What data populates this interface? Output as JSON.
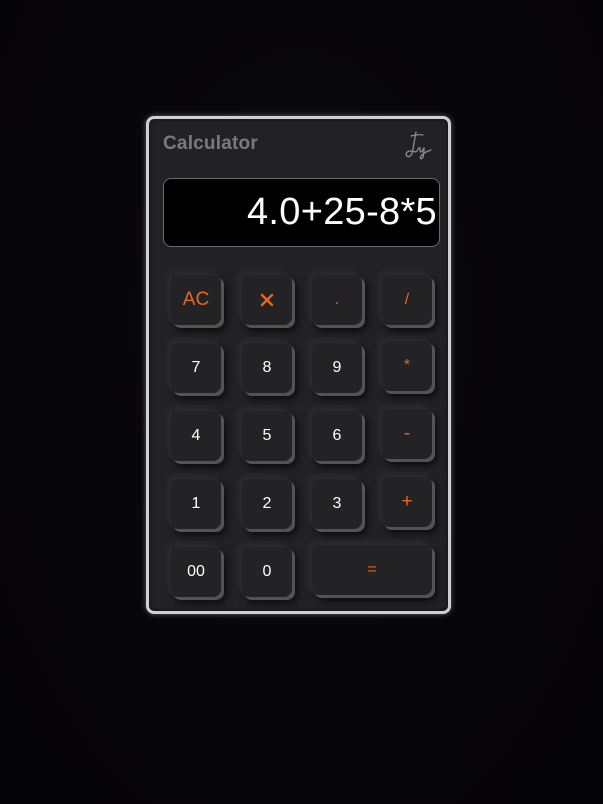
{
  "app": {
    "title": "Calculator"
  },
  "display": {
    "expression": "4.0+25-8*5"
  },
  "keys": {
    "row1": {
      "clear": "AC",
      "dot": ".",
      "divide": "/"
    },
    "row2": {
      "seven": "7",
      "eight": "8",
      "nine": "9",
      "multiply": "*"
    },
    "row3": {
      "four": "4",
      "five": "5",
      "six": "6",
      "subtract": "-"
    },
    "row4": {
      "one": "1",
      "two": "2",
      "three": "3",
      "add": "+"
    },
    "row5": {
      "double_zero": "00",
      "zero": "0",
      "equals": "="
    }
  },
  "icons": {
    "backspace": "close-icon",
    "signature": "signature-logo"
  },
  "colors": {
    "accent": "#e8661e",
    "body": "#222224",
    "display_bg": "#000000",
    "digit_text": "#ffffff",
    "title_text": "#7a7a7e"
  }
}
